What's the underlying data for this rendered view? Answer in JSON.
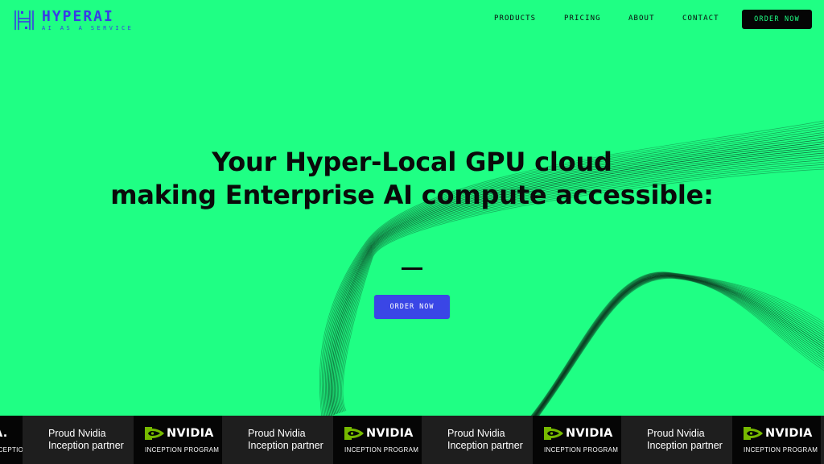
{
  "brand": {
    "name": "HYPERAI",
    "tagline": "AI AS A SERVICE",
    "colors": {
      "background": "#1fff84",
      "logo": "#3a3ae6",
      "primary_button": "#3a46e6",
      "dark": "#050505"
    }
  },
  "nav": {
    "products": "PRODUCTS",
    "pricing": "PRICING",
    "about": "ABOUT",
    "contact": "CONTACT",
    "order_now": "ORDER NOW"
  },
  "hero": {
    "line1": "Your Hyper-Local GPU cloud",
    "line2": "making Enterprise AI compute accessible:",
    "order_now": "ORDER NOW"
  },
  "marquee": {
    "partner_line1": "Proud Nvidia",
    "partner_line2": "Inception partner",
    "nvidia_wordmark": "NVIDIA",
    "nvidia_program": "INCEPTION PROGRAM",
    "nvidia_wordmark_clipped": "A."
  }
}
